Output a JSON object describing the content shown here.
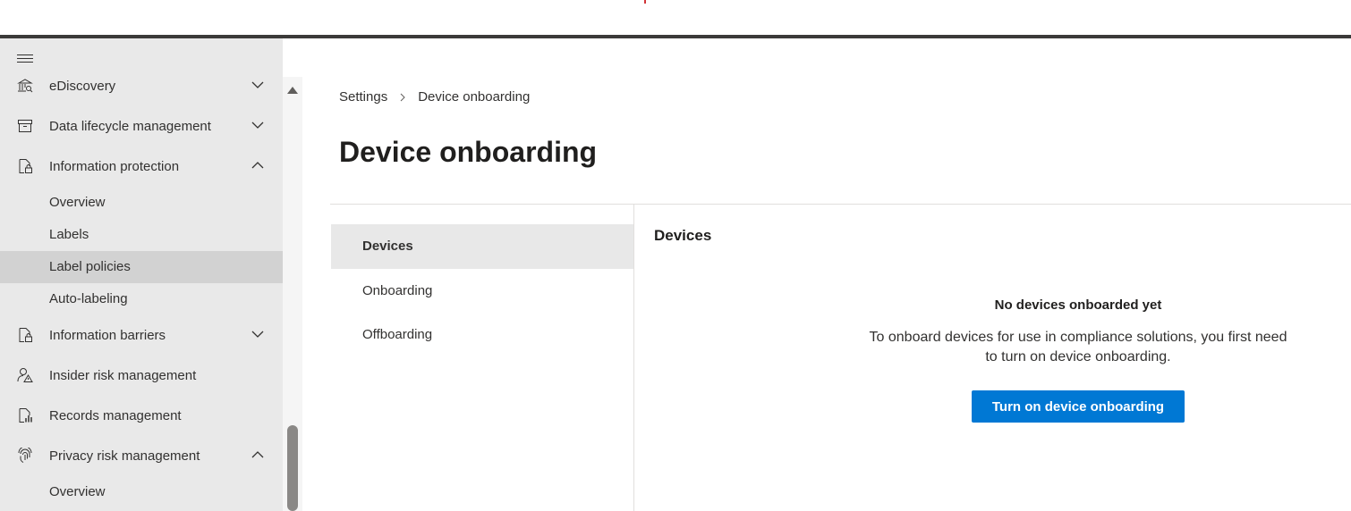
{
  "nav": {
    "menu_icon": "hamburger-icon",
    "items": [
      {
        "label": "eDiscovery",
        "icon": "ediscovery-icon",
        "expanded": false
      },
      {
        "label": "Data lifecycle management",
        "icon": "archive-icon",
        "expanded": false
      },
      {
        "label": "Information protection",
        "icon": "document-lock-icon",
        "expanded": true
      },
      {
        "label": "Information barriers",
        "icon": "document-lock-icon",
        "expanded": false
      },
      {
        "label": "Insider risk management",
        "icon": "person-warning-icon",
        "expanded": false
      },
      {
        "label": "Records management",
        "icon": "document-chart-icon",
        "expanded": false
      },
      {
        "label": "Privacy risk management",
        "icon": "fingerprint-icon",
        "expanded": true
      }
    ],
    "information_protection_children": [
      "Overview",
      "Labels",
      "Label policies",
      "Auto-labeling"
    ],
    "privacy_children": [
      "Overview"
    ],
    "selected": "Label policies"
  },
  "breadcrumb": {
    "items": [
      "Settings",
      "Device onboarding"
    ]
  },
  "page": {
    "title": "Device onboarding"
  },
  "tabs": [
    {
      "label": "Devices",
      "active": true
    },
    {
      "label": "Onboarding",
      "active": false
    },
    {
      "label": "Offboarding",
      "active": false
    }
  ],
  "devices": {
    "section_title": "Devices",
    "empty_heading": "No devices onboarded yet",
    "empty_desc": "To onboard devices for use in compliance solutions, you first need to turn on device onboarding.",
    "button_label": "Turn on device onboarding"
  },
  "colors": {
    "accent": "#0078d4",
    "sidebar_bg": "#e9e9e9",
    "selected_bg": "#d2d2d2",
    "topbar_line": "#3b3a39"
  }
}
